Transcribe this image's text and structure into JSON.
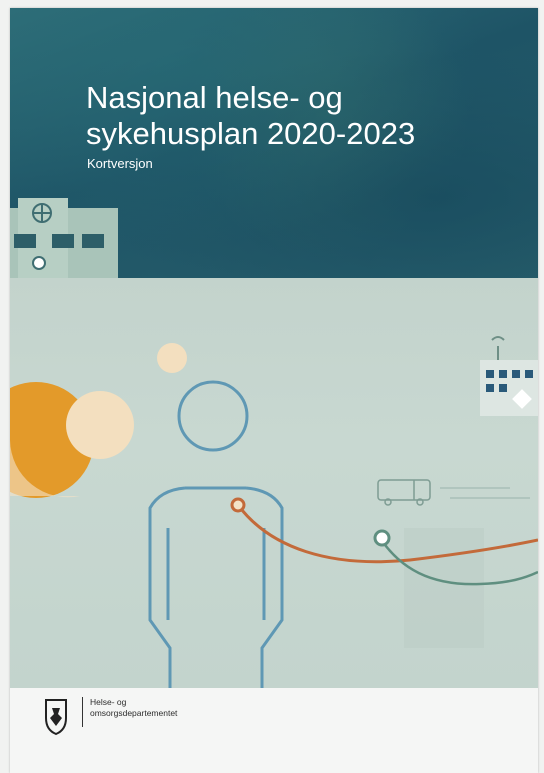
{
  "cover": {
    "title": "Nasjonal helse- og sykehusplan 2020-2023",
    "subtitle": "Kortversjon",
    "publisher_line1": "Helse- og",
    "publisher_line2": "omsorgsdepartementet"
  },
  "colors": {
    "top_band": "#235c6b",
    "mid_band": "#c5d5ce",
    "orange_sun": "#e39a2a",
    "cream_circle": "#f3dfbf",
    "figure_outline": "#5f98b4",
    "orange_line": "#c36a3a",
    "green_line": "#5f8f80"
  },
  "icons": [
    "hospital-building-icon",
    "person-figure-icon",
    "ambulance-icon",
    "coat-of-arms-icon"
  ]
}
